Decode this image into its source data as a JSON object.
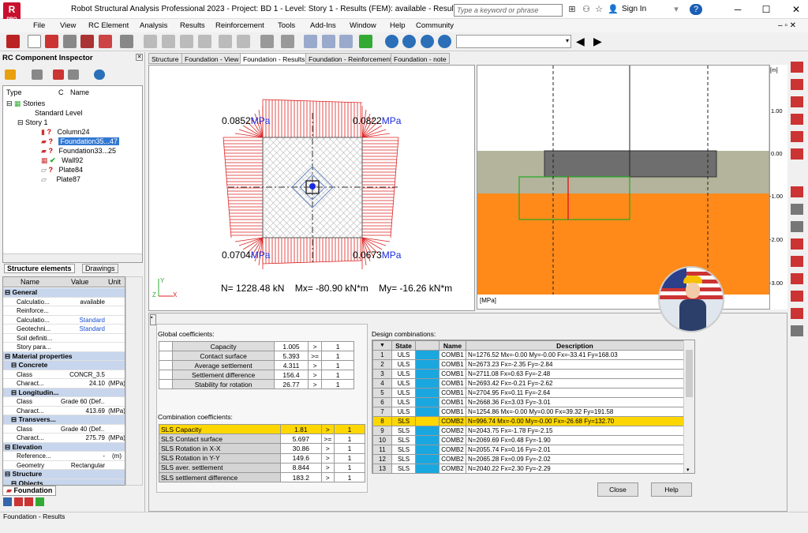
{
  "app": {
    "logo_top": "R",
    "logo_bottom": "PRO",
    "title": "Robot Structural Analysis Professional 2023 - Project: BD 1 - Level: Story 1 - Results (FEM): available - Results: available",
    "search_placeholder": "Type a keyword or phrase",
    "sign_in": "Sign In"
  },
  "menu": [
    "File",
    "View",
    "RC Element",
    "Analysis",
    "Results",
    "Reinforcement",
    "Tools",
    "Add-Ins",
    "Window",
    "Help",
    "Community"
  ],
  "left": {
    "title": "RC Component  Inspector",
    "tree_headers": {
      "type": "Type",
      "c": "C",
      "name": "Name"
    },
    "tree": [
      {
        "label": "Stories",
        "indent": 0,
        "status": ""
      },
      {
        "label": "Standard Level",
        "indent": 1,
        "status": ""
      },
      {
        "label": "Story 1",
        "indent": 1,
        "status": ""
      },
      {
        "label": "Column24",
        "indent": 2,
        "status": "?"
      },
      {
        "label": "Foundation35...47",
        "indent": 2,
        "status": "?",
        "selected": true
      },
      {
        "label": "Foundation33...25",
        "indent": 2,
        "status": "?"
      },
      {
        "label": "Wall92",
        "indent": 2,
        "status": "✔"
      },
      {
        "label": "Plate84",
        "indent": 2,
        "status": "?"
      },
      {
        "label": "Plate87",
        "indent": 2,
        "status": ""
      }
    ],
    "tabs": [
      "Structure elements",
      "Drawings"
    ],
    "prop_headers": {
      "name": "Name",
      "value": "Value",
      "unit": "Unit"
    },
    "props": [
      {
        "g": true,
        "n": "General"
      },
      {
        "n": "Calculatio...",
        "v": "available",
        "u": ""
      },
      {
        "n": "Reinforce...",
        "v": "",
        "u": ""
      },
      {
        "n": "Calculatio...",
        "v": "Standard",
        "u": "",
        "blue": true
      },
      {
        "n": "Geotechni...",
        "v": "Standard",
        "u": "",
        "blue": true
      },
      {
        "n": "Soil definiti...",
        "v": "",
        "u": ""
      },
      {
        "n": "Story para...",
        "v": "",
        "u": ""
      },
      {
        "g": true,
        "n": "Material properties"
      },
      {
        "g": true,
        "n": "Concrete",
        "sub": true
      },
      {
        "n": "Class",
        "v": "CONCR_3.5",
        "u": ""
      },
      {
        "n": "Charact...",
        "v": "24.10",
        "u": "(MPa)"
      },
      {
        "g": true,
        "n": "Longitudin...",
        "sub": true
      },
      {
        "n": "Class",
        "v": "Grade 60 (Def...",
        "u": ""
      },
      {
        "n": "Charact...",
        "v": "413.69",
        "u": "(MPa)"
      },
      {
        "g": true,
        "n": "Transvers...",
        "sub": true
      },
      {
        "n": "Class",
        "v": "Grade 40 (Def...",
        "u": ""
      },
      {
        "n": "Charact...",
        "v": "275.79",
        "u": "(MPa)"
      },
      {
        "g": true,
        "n": "Elevation"
      },
      {
        "n": "Reference...",
        "v": "-",
        "u": "(m)"
      },
      {
        "n": "Geometry",
        "v": "Rectangular",
        "u": ""
      },
      {
        "g": true,
        "n": "Structure"
      },
      {
        "g": true,
        "n": "Objects",
        "sub": true
      }
    ],
    "bottom_tab": "Foundation"
  },
  "tabs": [
    "Structure",
    "Foundation - View",
    "Foundation - Results",
    "Foundation - Reinforcement",
    "Foundation - note"
  ],
  "view1": {
    "tl": "0.0852",
    "tr": "0.0822",
    "bl": "0.0704",
    "br": "0.0673",
    "unit": "MPa",
    "summary": "N= 1228.48 kN    Mx= -80.90 kN*m    My= -16.26 kN*m",
    "ax_y": "Y",
    "ax_z": "Z",
    "ax_x": "X"
  },
  "view2": {
    "unit_top": "[m]",
    "unit_bottom": "[MPa]",
    "ticks": [
      "1.00",
      "0.00",
      "-1.00",
      "-2.00",
      "-3.00"
    ]
  },
  "global": {
    "title": "Global coefficients:",
    "rows": [
      [
        "Capacity",
        "1.005",
        ">",
        "1"
      ],
      [
        "Contact surface",
        "5.393",
        ">=",
        "1"
      ],
      [
        "Average settlement",
        "4.311",
        ">",
        "1"
      ],
      [
        "Settlement difference",
        "156.4",
        ">",
        "1"
      ],
      [
        "Stability for rotation",
        "26.77",
        ">",
        "1"
      ]
    ]
  },
  "combo": {
    "title": "Combination coefficients:",
    "rows": [
      [
        "SLS Capacity",
        "1.81",
        ">",
        "1"
      ],
      [
        "SLS Contact surface",
        "5.697",
        ">=",
        "1"
      ],
      [
        "SLS Rotation in X-X",
        "30.86",
        ">",
        "1"
      ],
      [
        "SLS Rotation in Y-Y",
        "149.6",
        ">",
        "1"
      ],
      [
        "SLS aver. settlement",
        "8.844",
        ">",
        "1"
      ],
      [
        "SLS settlement difference",
        "183.2",
        ">",
        "1"
      ]
    ]
  },
  "design": {
    "title": "Design combinations:",
    "headers": [
      "State",
      "Name",
      "Description"
    ],
    "rows": [
      [
        "1",
        "ULS",
        "COMB1",
        "N=1276.52 Mx=-0.00 My=-0.00 Fx=-33.41 Fy=168.03"
      ],
      [
        "2",
        "ULS",
        "COMB1",
        "N=2673.23 Fx=-2.35 Fy=-2.84"
      ],
      [
        "3",
        "ULS",
        "COMB1",
        "N=2711.08 Fx=0.63 Fy=-2.48"
      ],
      [
        "4",
        "ULS",
        "COMB1",
        "N=2693.42 Fx=-0.21 Fy=-2.62"
      ],
      [
        "5",
        "ULS",
        "COMB1",
        "N=2704.95 Fx=0.11 Fy=-2.64"
      ],
      [
        "6",
        "ULS",
        "COMB1",
        "N=2668.36 Fx=3.03 Fy=-3.01"
      ],
      [
        "7",
        "ULS",
        "COMB1",
        "N=1254.86 Mx=-0.00 My=0.00 Fx=39.32 Fy=191.58"
      ],
      [
        "8",
        "SLS",
        "COMB2",
        "N=996.74 Mx=-0.00 My=-0.00 Fx=-26.68 Fy=132.70"
      ],
      [
        "9",
        "SLS",
        "COMB2",
        "N=2043.75 Fx=-1.78 Fy=-2.15"
      ],
      [
        "10",
        "SLS",
        "COMB2",
        "N=2069.69 Fx=0.48 Fy=-1.90"
      ],
      [
        "11",
        "SLS",
        "COMB2",
        "N=2055.74 Fx=0.16 Fy=-2.01"
      ],
      [
        "12",
        "SLS",
        "COMB2",
        "N=2065.28 Fx=0.09 Fy=-2.02"
      ],
      [
        "13",
        "SLS",
        "COMB2",
        "N=2040.22 Fx=2.30 Fy=-2.29"
      ]
    ]
  },
  "buttons": {
    "close": "Close",
    "help": "Help"
  },
  "status": "Foundation - Results"
}
